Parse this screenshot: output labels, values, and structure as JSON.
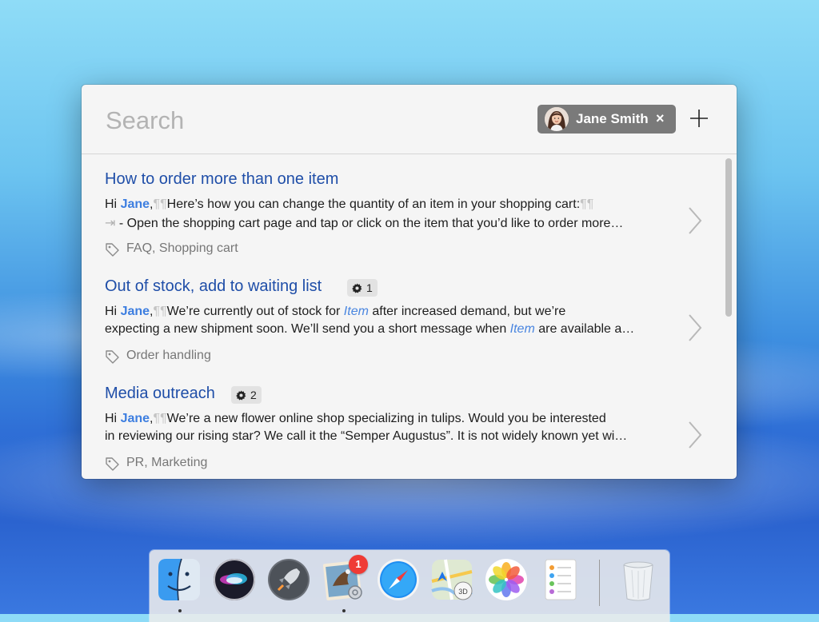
{
  "search": {
    "placeholder": "Search"
  },
  "user_chip": {
    "name": "Jane Smith",
    "remove": "×"
  },
  "results": [
    {
      "title": "How to order more than one item",
      "greeting": "Hi ",
      "name": "Jane",
      "line1_rest": ",¶¶Here’s how you can change the quantity of an item in your shopping cart:¶¶",
      "tab_glyph": "⇥",
      "line2_rest": " - Open the shopping cart page and tap or click on the item that you’d like to order more…",
      "tags": "FAQ, Shopping cart"
    },
    {
      "title": "Out of stock, add to waiting list",
      "badge_count": "1",
      "greeting": "Hi ",
      "name": "Jane",
      "line1_a": ",¶¶We’re  currently out of stock for ",
      "item1": "Item",
      "line1_b": " after increased demand, but we’re",
      "line2_a": "expecting a new shipment soon. We’ll send you a short message when ",
      "item2": "Item",
      "line2_b": " are available a…",
      "tags": "Order handling"
    },
    {
      "title": "Media outreach",
      "badge_count": "2",
      "greeting": "Hi ",
      "name": "Jane",
      "line1_rest": ",¶¶We’re a new flower online shop specializing in tulips. Would you be interested",
      "line2": "in reviewing our rising star? We call it the “Semper Augustus”. It is not widely known yet wi…",
      "tags": "PR, Marketing"
    }
  ],
  "dock": {
    "items": [
      "finder-icon",
      "siri-icon",
      "launchpad-icon",
      "mail-icon",
      "safari-icon",
      "maps-icon",
      "photos-icon",
      "reminders-icon",
      "trash-icon"
    ],
    "mail_badge": "1"
  },
  "colors": {
    "title_link": "#1f4ea8",
    "highlight": "#3d7ee0",
    "chip_bg": "#7a7a7a",
    "panel_bg": "#f5f5f5"
  }
}
